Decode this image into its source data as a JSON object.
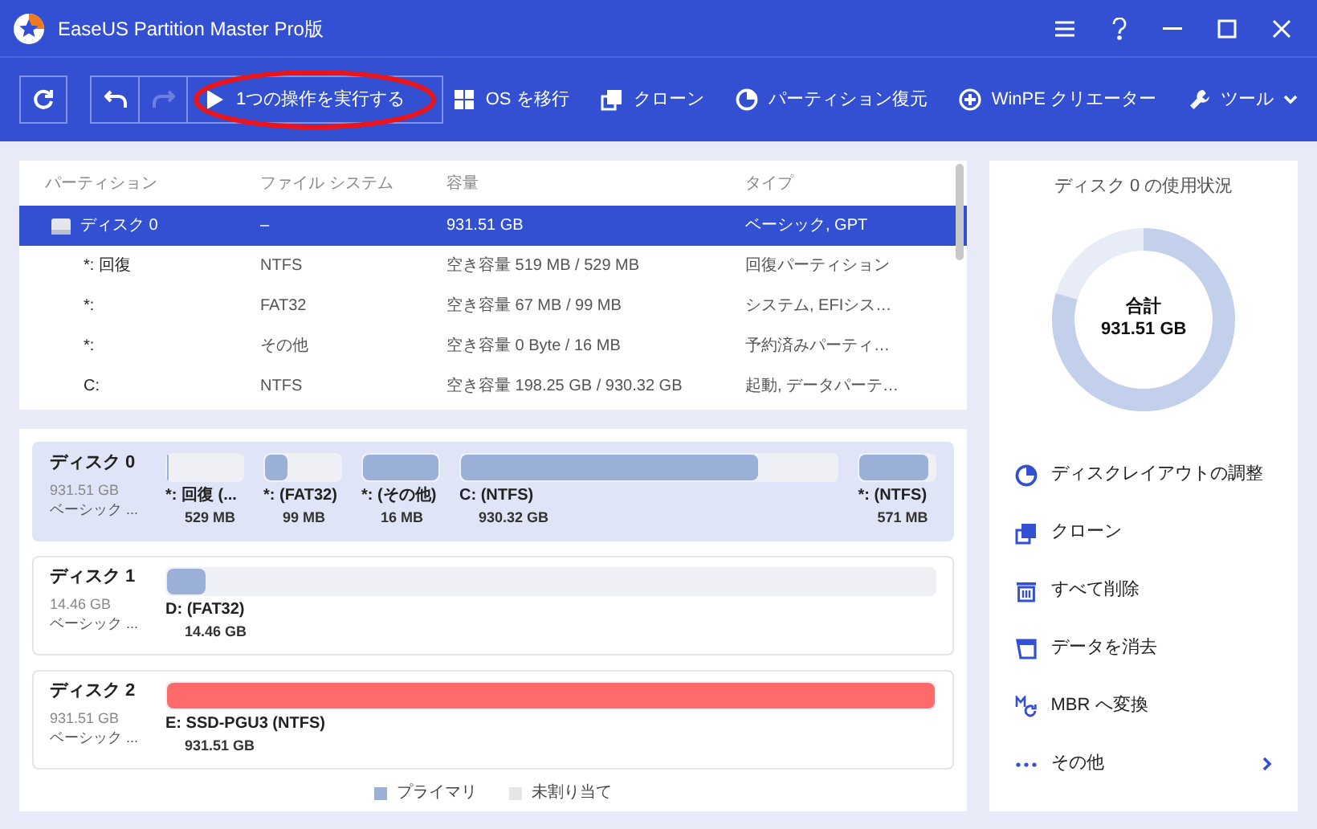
{
  "window": {
    "title": "EaseUS Partition Master Pro版"
  },
  "toolbar": {
    "run_button": "1つの操作を実行する",
    "redo_disabled": true,
    "actions": [
      {
        "kind": "windows",
        "label": "OS を移行"
      },
      {
        "kind": "clone",
        "label": "クローン"
      },
      {
        "kind": "pie",
        "label": "パーティション復元"
      },
      {
        "kind": "plus",
        "label": "WinPE クリエーター"
      },
      {
        "kind": "wrench",
        "label": "ツール"
      }
    ]
  },
  "table": {
    "columns": [
      "パーティション",
      "ファイル システム",
      "容量",
      "タイプ"
    ],
    "rows": [
      {
        "kind": "disk",
        "selected": true,
        "cells": [
          "ディスク 0",
          "–",
          "931.51 GB",
          "ベーシック, GPT"
        ]
      },
      {
        "kind": "partition",
        "selected": false,
        "cells": [
          "*: 回復",
          "NTFS",
          "空き容量 519 MB / 529 MB",
          "回復パーティション"
        ]
      },
      {
        "kind": "partition",
        "selected": false,
        "cells": [
          "*:",
          "FAT32",
          "空き容量 67 MB / 99 MB",
          "システム, EFIシス…"
        ]
      },
      {
        "kind": "partition",
        "selected": false,
        "cells": [
          "*:",
          "その他",
          "空き容量 0 Byte / 16 MB",
          "予約済みパーティ…"
        ]
      },
      {
        "kind": "partition",
        "selected": false,
        "cells": [
          "C:",
          "NTFS",
          "空き容量 198.25 GB / 930.32 GB",
          "起動, データパーテ…"
        ]
      }
    ]
  },
  "disks": [
    {
      "name": "ディスク 0",
      "size": "931.51 GB",
      "type": "ベーシック ...",
      "selected": true,
      "partitions": [
        {
          "label": "*: 回復 (...",
          "size": "529 MB",
          "level": 0.02,
          "wide": false,
          "color": "#9ab0d6"
        },
        {
          "label": "*: (FAT32)",
          "size": "99 MB",
          "level": 0.3,
          "wide": false,
          "color": "#9ab0d6"
        },
        {
          "label": "*: (その他)",
          "size": "16 MB",
          "level": 1,
          "wide": false,
          "color": "#9ab0d6"
        },
        {
          "label": "C: (NTFS)",
          "size": "930.32 GB",
          "level": 0.79,
          "wide": true,
          "color": "#9ab0d6"
        },
        {
          "label": "*: (NTFS)",
          "size": "571 MB",
          "level": 0.9,
          "wide": false,
          "color": "#9ab0d6"
        }
      ]
    },
    {
      "name": "ディスク 1",
      "size": "14.46 GB",
      "type": "ベーシック ...",
      "selected": false,
      "partitions": [
        {
          "label": "D: (FAT32)",
          "size": "14.46 GB",
          "level": 0.05,
          "wide": true,
          "color": "#9ab0d6"
        }
      ]
    },
    {
      "name": "ディスク 2",
      "size": "931.51 GB",
      "type": "ベーシック ...",
      "selected": false,
      "partitions": [
        {
          "label": "E: SSD-PGU3 (NTFS)",
          "size": "931.51 GB",
          "level": 1,
          "wide": true,
          "color": "#ff6b6b"
        }
      ]
    }
  ],
  "legend": [
    {
      "label": "プライマリ",
      "color": "#9ab0d6"
    },
    {
      "label": "未割り当て",
      "color": "#e6e6e6"
    }
  ],
  "usage": {
    "title": "ディスク 0 の使用状況",
    "center_label": "合計",
    "center_value": "931.51 GB"
  },
  "side_actions": [
    {
      "kind": "pie",
      "label": "ディスクレイアウトの調整"
    },
    {
      "kind": "clone",
      "label": "クローン"
    },
    {
      "kind": "trash",
      "label": "すべて削除"
    },
    {
      "kind": "wipe",
      "label": "データを消去"
    },
    {
      "kind": "mbr",
      "label": "MBR へ変換"
    },
    {
      "kind": "more",
      "label": "その他"
    }
  ]
}
